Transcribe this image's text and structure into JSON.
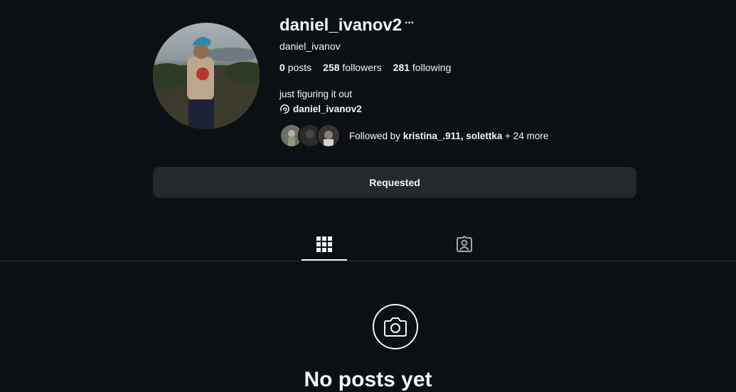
{
  "profile": {
    "username": "daniel_ivanov2",
    "more_label": "···",
    "full_name": "daniel_ivanov",
    "stats": {
      "posts_count": "0",
      "posts_label": "posts",
      "followers_count": "258",
      "followers_label": "followers",
      "following_count": "281",
      "following_label": "following"
    },
    "bio": "just figuring it out",
    "threads_handle": "daniel_ivanov2",
    "followed_by": {
      "prefix": "Followed by",
      "names": "kristina_.911, solettka",
      "suffix": "+ 24 more"
    }
  },
  "actions": {
    "requested_label": "Requested"
  },
  "tabs": [
    {
      "icon": "grid-icon",
      "active": true
    },
    {
      "icon": "tagged-icon",
      "active": false
    }
  ],
  "empty_state": {
    "icon": "camera-icon",
    "title": "No posts yet"
  },
  "colors": {
    "background": "#0c1014",
    "button": "#25292e",
    "text": "#f5f5f5"
  }
}
